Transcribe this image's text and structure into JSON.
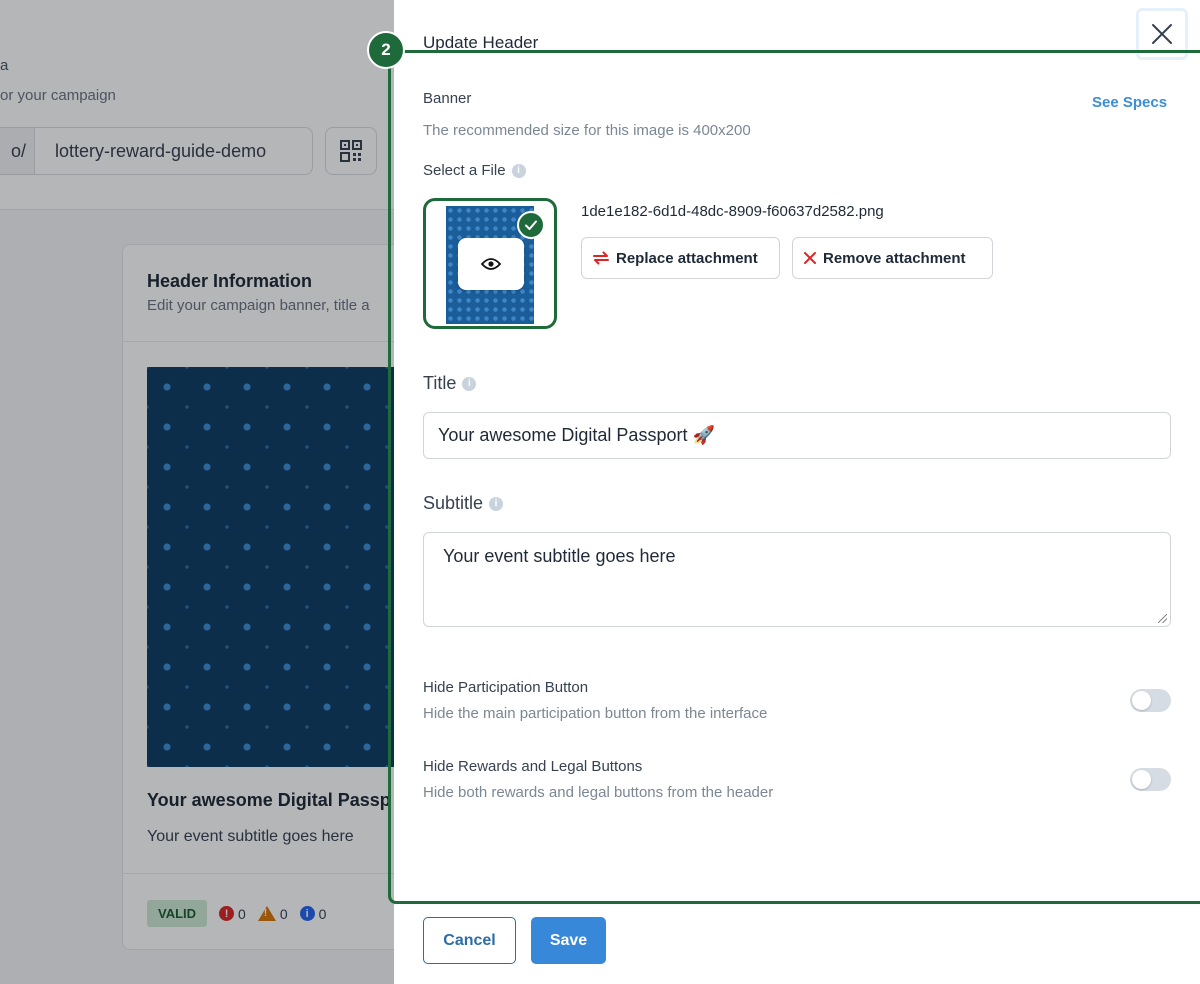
{
  "background": {
    "title_fragment": "a",
    "description_fragment": "or your campaign",
    "url_prefix": "o/",
    "url_slug": "lottery-reward-guide-demo",
    "card": {
      "title": "Header Information",
      "subtitle": "Edit your campaign banner, title a",
      "preview_title": "Your awesome Digital Passp",
      "preview_subtitle": "Your event subtitle goes here",
      "status_badge": "VALID",
      "error_count": "0",
      "warning_count": "0",
      "info_count": "0"
    }
  },
  "drawer": {
    "title": "Update Header",
    "step_number": "2",
    "banner": {
      "label": "Banner",
      "see_specs": "See Specs",
      "hint": "The recommended size for this image is 400x200",
      "select_label": "Select a File",
      "file_name": "1de1e182-6d1d-48dc-8909-f60637d2582.png",
      "replace_label": "Replace attachment",
      "remove_label": "Remove attachment"
    },
    "title_field": {
      "label": "Title",
      "value": "Your awesome Digital Passport 🚀"
    },
    "subtitle_field": {
      "label": "Subtitle",
      "value": "Your event subtitle goes here"
    },
    "toggles": [
      {
        "label": "Hide Participation Button",
        "description": "Hide the main participation button from the interface",
        "enabled": false
      },
      {
        "label": "Hide Rewards and Legal Buttons",
        "description": "Hide both rewards and legal buttons from the header",
        "enabled": false
      }
    ],
    "cancel_label": "Cancel",
    "save_label": "Save"
  },
  "colors": {
    "accent": "#3788d8",
    "highlight": "#1f6a3a",
    "valid_badge": "#cde9d3"
  },
  "icons": [
    "qr-code-icon",
    "error-icon",
    "warning-icon",
    "info-icon",
    "close-icon",
    "eye-icon",
    "check-icon",
    "replace-icon",
    "remove-icon"
  ]
}
